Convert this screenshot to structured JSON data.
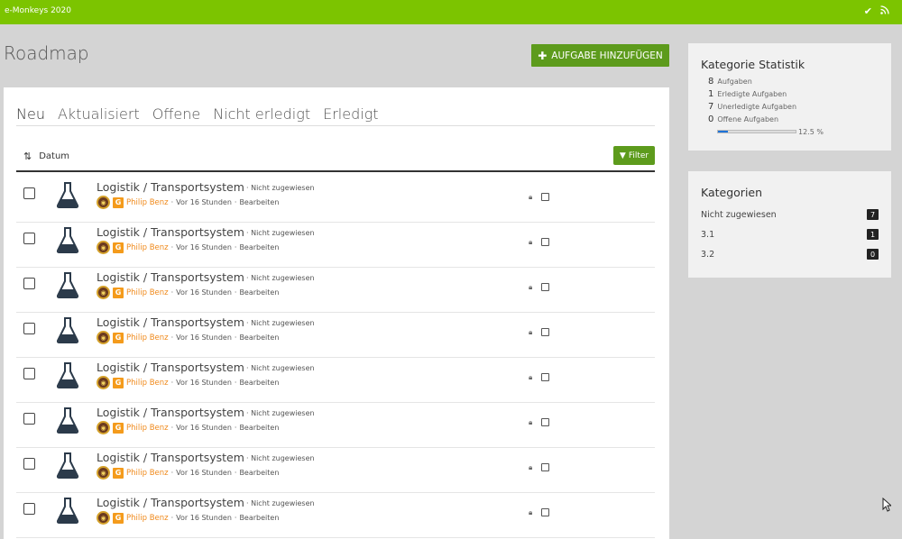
{
  "topbar": {
    "brand": "e-Monkeys 2020",
    "icons": [
      "check-icon",
      "rss-icon"
    ]
  },
  "page": {
    "title": "Roadmap"
  },
  "actions": {
    "add_task_label": "AUFGABE HINZUFÜGEN"
  },
  "tabs": [
    {
      "label": "Neu",
      "active": true
    },
    {
      "label": "Aktualisiert",
      "active": false
    },
    {
      "label": "Offene",
      "active": false
    },
    {
      "label": "Nicht erledigt",
      "active": false
    },
    {
      "label": "Erledigt",
      "active": false
    }
  ],
  "sort": {
    "label": "Datum"
  },
  "filter": {
    "label": "Filter"
  },
  "tasks": [
    {
      "title": "Logistik / Transportsystem",
      "assignment": "Nicht zugewiesen",
      "user": "Philip Benz",
      "badge_letter": "G",
      "time": "Vor 16 Stunden",
      "action": "Bearbeiten",
      "separator": "·"
    },
    {
      "title": "Logistik / Transportsystem",
      "assignment": "Nicht zugewiesen",
      "user": "Philip Benz",
      "badge_letter": "G",
      "time": "Vor 16 Stunden",
      "action": "Bearbeiten",
      "separator": "·"
    },
    {
      "title": "Logistik / Transportsystem",
      "assignment": "Nicht zugewiesen",
      "user": "Philip Benz",
      "badge_letter": "G",
      "time": "Vor 16 Stunden",
      "action": "Bearbeiten",
      "separator": "·"
    },
    {
      "title": "Logistik / Transportsystem",
      "assignment": "Nicht zugewiesen",
      "user": "Philip Benz",
      "badge_letter": "G",
      "time": "Vor 16 Stunden",
      "action": "Bearbeiten",
      "separator": "·"
    },
    {
      "title": "Logistik / Transportsystem",
      "assignment": "Nicht zugewiesen",
      "user": "Philip Benz",
      "badge_letter": "G",
      "time": "Vor 16 Stunden",
      "action": "Bearbeiten",
      "separator": "·"
    },
    {
      "title": "Logistik / Transportsystem",
      "assignment": "Nicht zugewiesen",
      "user": "Philip Benz",
      "badge_letter": "G",
      "time": "Vor 16 Stunden",
      "action": "Bearbeiten",
      "separator": "·"
    },
    {
      "title": "Logistik / Transportsystem",
      "assignment": "Nicht zugewiesen",
      "user": "Philip Benz",
      "badge_letter": "G",
      "time": "Vor 16 Stunden",
      "action": "Bearbeiten",
      "separator": "·"
    },
    {
      "title": "Logistik / Transportsystem",
      "assignment": "Nicht zugewiesen",
      "user": "Philip Benz",
      "badge_letter": "G",
      "time": "Vor 16 Stunden",
      "action": "Bearbeiten",
      "separator": "·"
    }
  ],
  "stats": {
    "title": "Kategorie Statistik",
    "items": [
      {
        "value": "8",
        "label": "Aufgaben"
      },
      {
        "value": "1",
        "label": "Erledigte Aufgaben"
      },
      {
        "value": "7",
        "label": "Unerledigte Aufgaben"
      },
      {
        "value": "0",
        "label": "Offene Aufgaben"
      }
    ],
    "progress_percent": 12.5,
    "progress_label": "12.5 %"
  },
  "categories": {
    "title": "Kategorien",
    "items": [
      {
        "name": "Nicht zugewiesen",
        "count": "7"
      },
      {
        "name": "3.1",
        "count": "1"
      },
      {
        "name": "3.2",
        "count": "0"
      }
    ]
  },
  "colors": {
    "accent": "#7cc400",
    "button": "#5d9b1c",
    "user": "#f08a1c",
    "progress": "#1e73d8"
  }
}
